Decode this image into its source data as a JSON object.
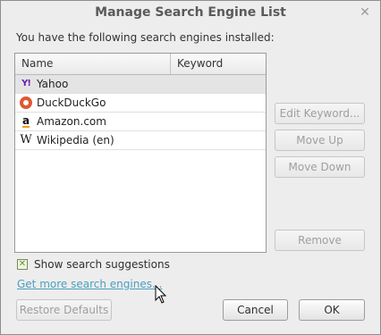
{
  "window": {
    "title": "Manage Search Engine List",
    "close_icon": "close-icon"
  },
  "intro_text": "You have the following search engines installed:",
  "table": {
    "columns": [
      "Name",
      "Keyword"
    ],
    "rows": [
      {
        "name": "Yahoo",
        "keyword": "",
        "icon": "yahoo-icon",
        "selected": true
      },
      {
        "name": "DuckDuckGo",
        "keyword": "",
        "icon": "duckduckgo-icon",
        "selected": false
      },
      {
        "name": "Amazon.com",
        "keyword": "",
        "icon": "amazon-icon",
        "selected": false
      },
      {
        "name": "Wikipedia (en)",
        "keyword": "",
        "icon": "wikipedia-icon",
        "selected": false
      }
    ]
  },
  "side_buttons": {
    "edit_keyword": "Edit Keyword...",
    "move_up": "Move Up",
    "move_down": "Move Down",
    "remove": "Remove"
  },
  "suggestions": {
    "label": "Show search suggestions",
    "checked": true
  },
  "get_more_link": "Get more search engines...",
  "footer": {
    "restore_defaults": "Restore Defaults",
    "cancel": "Cancel",
    "ok": "OK"
  },
  "colors": {
    "link": "#4a9fc0",
    "selected_row": "#e4e4e4",
    "disabled_text": "#9f9f9f"
  }
}
